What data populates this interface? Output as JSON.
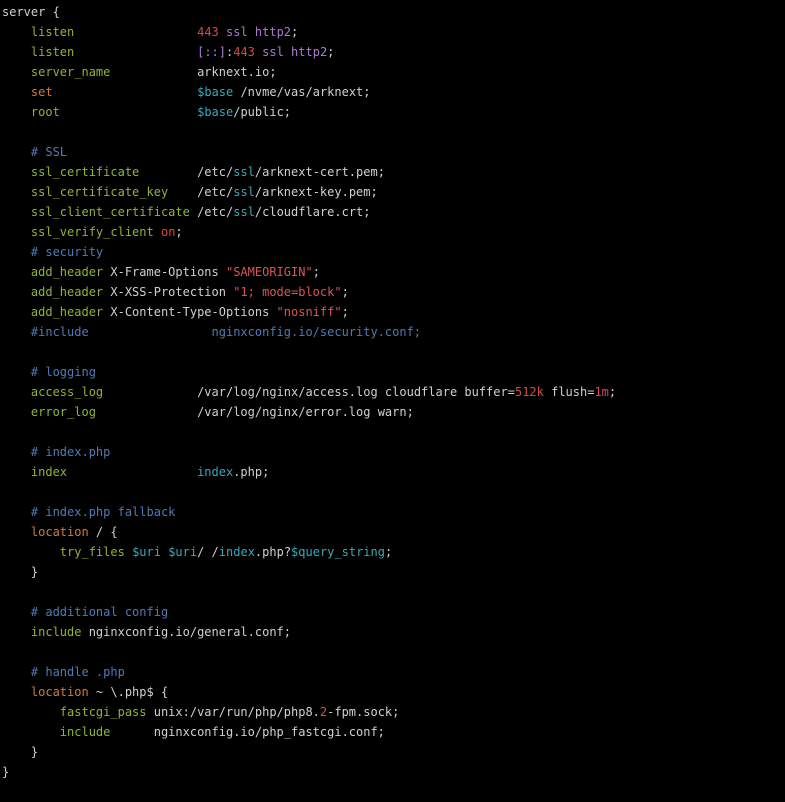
{
  "colors": {
    "background": "#000000",
    "text": "#d0d0d0",
    "keyword": "#8fb33a",
    "number": "#d74a4a",
    "modifier": "#a87bd0",
    "comment": "#4f7ab8",
    "string": "#d85555",
    "variable": "#3aa8b8",
    "location": "#d07a3a"
  },
  "lines": [
    [
      {
        "t": "server {",
        "c": "w"
      }
    ],
    [
      {
        "t": "    ",
        "c": "w"
      },
      {
        "t": "listen",
        "c": "k"
      },
      {
        "t": "                 ",
        "c": "w"
      },
      {
        "t": "443",
        "c": "n"
      },
      {
        "t": " ssl http2",
        "c": "m"
      },
      {
        "t": ";",
        "c": "w"
      }
    ],
    [
      {
        "t": "    ",
        "c": "w"
      },
      {
        "t": "listen",
        "c": "k"
      },
      {
        "t": "                 ",
        "c": "w"
      },
      {
        "t": "[::]",
        "c": "m"
      },
      {
        "t": ":",
        "c": "w"
      },
      {
        "t": "443",
        "c": "n"
      },
      {
        "t": " ssl http2",
        "c": "m"
      },
      {
        "t": ";",
        "c": "w"
      }
    ],
    [
      {
        "t": "    ",
        "c": "w"
      },
      {
        "t": "server_name",
        "c": "k"
      },
      {
        "t": "            arknext.io;",
        "c": "w"
      }
    ],
    [
      {
        "t": "    ",
        "c": "w"
      },
      {
        "t": "set",
        "c": "o"
      },
      {
        "t": "                    ",
        "c": "w"
      },
      {
        "t": "$base",
        "c": "v"
      },
      {
        "t": " /nvme/vas/arknext;",
        "c": "w"
      }
    ],
    [
      {
        "t": "    ",
        "c": "w"
      },
      {
        "t": "root",
        "c": "k"
      },
      {
        "t": "                   ",
        "c": "w"
      },
      {
        "t": "$base",
        "c": "v"
      },
      {
        "t": "/public;",
        "c": "w"
      }
    ],
    [
      {
        "t": "",
        "c": "w"
      }
    ],
    [
      {
        "t": "    ",
        "c": "w"
      },
      {
        "t": "# SSL",
        "c": "c"
      }
    ],
    [
      {
        "t": "    ",
        "c": "w"
      },
      {
        "t": "ssl_certificate",
        "c": "k"
      },
      {
        "t": "        /etc/",
        "c": "w"
      },
      {
        "t": "ssl",
        "c": "t"
      },
      {
        "t": "/arknext-cert.pem;",
        "c": "w"
      }
    ],
    [
      {
        "t": "    ",
        "c": "w"
      },
      {
        "t": "ssl_certificate_key",
        "c": "k"
      },
      {
        "t": "    /etc/",
        "c": "w"
      },
      {
        "t": "ssl",
        "c": "t"
      },
      {
        "t": "/arknext-key.pem;",
        "c": "w"
      }
    ],
    [
      {
        "t": "    ",
        "c": "w"
      },
      {
        "t": "ssl_client_certificate",
        "c": "k"
      },
      {
        "t": " /etc/",
        "c": "w"
      },
      {
        "t": "ssl",
        "c": "t"
      },
      {
        "t": "/cloudflare.crt;",
        "c": "w"
      }
    ],
    [
      {
        "t": "    ",
        "c": "w"
      },
      {
        "t": "ssl_verify_client",
        "c": "k"
      },
      {
        "t": " ",
        "c": "w"
      },
      {
        "t": "on",
        "c": "n"
      },
      {
        "t": ";",
        "c": "w"
      }
    ],
    [
      {
        "t": "    ",
        "c": "w"
      },
      {
        "t": "# security",
        "c": "c"
      }
    ],
    [
      {
        "t": "    ",
        "c": "w"
      },
      {
        "t": "add_header",
        "c": "k"
      },
      {
        "t": " X-Frame-Options ",
        "c": "w"
      },
      {
        "t": "\"SAMEORIGIN\"",
        "c": "s"
      },
      {
        "t": ";",
        "c": "w"
      }
    ],
    [
      {
        "t": "    ",
        "c": "w"
      },
      {
        "t": "add_header",
        "c": "k"
      },
      {
        "t": " X-XSS-Protection ",
        "c": "w"
      },
      {
        "t": "\"1; mode=block\"",
        "c": "s"
      },
      {
        "t": ";",
        "c": "w"
      }
    ],
    [
      {
        "t": "    ",
        "c": "w"
      },
      {
        "t": "add_header",
        "c": "k"
      },
      {
        "t": " X-Content-Type-Options ",
        "c": "w"
      },
      {
        "t": "\"nosniff\"",
        "c": "s"
      },
      {
        "t": ";",
        "c": "w"
      }
    ],
    [
      {
        "t": "    ",
        "c": "w"
      },
      {
        "t": "#include                 nginxconfig.io/security.conf;",
        "c": "c"
      }
    ],
    [
      {
        "t": "",
        "c": "w"
      }
    ],
    [
      {
        "t": "    ",
        "c": "w"
      },
      {
        "t": "# logging",
        "c": "c"
      }
    ],
    [
      {
        "t": "    ",
        "c": "w"
      },
      {
        "t": "access_log",
        "c": "k"
      },
      {
        "t": "             /var/log/nginx/access.log cloudflare buffer=",
        "c": "w"
      },
      {
        "t": "512k",
        "c": "n"
      },
      {
        "t": " flush=",
        "c": "w"
      },
      {
        "t": "1m",
        "c": "n"
      },
      {
        "t": ";",
        "c": "w"
      }
    ],
    [
      {
        "t": "    ",
        "c": "w"
      },
      {
        "t": "error_log",
        "c": "k"
      },
      {
        "t": "              /var/log/nginx/error.log warn;",
        "c": "w"
      }
    ],
    [
      {
        "t": "",
        "c": "w"
      }
    ],
    [
      {
        "t": "    ",
        "c": "w"
      },
      {
        "t": "# index.php",
        "c": "c"
      }
    ],
    [
      {
        "t": "    ",
        "c": "w"
      },
      {
        "t": "index",
        "c": "k"
      },
      {
        "t": "                  ",
        "c": "w"
      },
      {
        "t": "index",
        "c": "t"
      },
      {
        "t": ".php;",
        "c": "w"
      }
    ],
    [
      {
        "t": "",
        "c": "w"
      }
    ],
    [
      {
        "t": "    ",
        "c": "w"
      },
      {
        "t": "# index.php fallback",
        "c": "c"
      }
    ],
    [
      {
        "t": "    ",
        "c": "w"
      },
      {
        "t": "location",
        "c": "o"
      },
      {
        "t": " / {",
        "c": "w"
      }
    ],
    [
      {
        "t": "        ",
        "c": "w"
      },
      {
        "t": "try_files",
        "c": "k"
      },
      {
        "t": " ",
        "c": "w"
      },
      {
        "t": "$uri",
        "c": "v"
      },
      {
        "t": " ",
        "c": "w"
      },
      {
        "t": "$uri",
        "c": "v"
      },
      {
        "t": "/ /",
        "c": "w"
      },
      {
        "t": "index",
        "c": "t"
      },
      {
        "t": ".php?",
        "c": "w"
      },
      {
        "t": "$query_string",
        "c": "v"
      },
      {
        "t": ";",
        "c": "w"
      }
    ],
    [
      {
        "t": "    }",
        "c": "w"
      }
    ],
    [
      {
        "t": "",
        "c": "w"
      }
    ],
    [
      {
        "t": "    ",
        "c": "w"
      },
      {
        "t": "# additional config",
        "c": "c"
      }
    ],
    [
      {
        "t": "    ",
        "c": "w"
      },
      {
        "t": "include",
        "c": "k"
      },
      {
        "t": " nginxconfig.io/general.conf;",
        "c": "w"
      }
    ],
    [
      {
        "t": "",
        "c": "w"
      }
    ],
    [
      {
        "t": "    ",
        "c": "w"
      },
      {
        "t": "# handle .php",
        "c": "c"
      }
    ],
    [
      {
        "t": "    ",
        "c": "w"
      },
      {
        "t": "location",
        "c": "o"
      },
      {
        "t": " ~ \\.php$ {",
        "c": "w"
      }
    ],
    [
      {
        "t": "        ",
        "c": "w"
      },
      {
        "t": "fastcgi_pass",
        "c": "k"
      },
      {
        "t": " unix:/var/run/php/php8.",
        "c": "w"
      },
      {
        "t": "2",
        "c": "n"
      },
      {
        "t": "-fpm.sock;",
        "c": "w"
      }
    ],
    [
      {
        "t": "        ",
        "c": "w"
      },
      {
        "t": "include",
        "c": "k"
      },
      {
        "t": "      nginxconfig.io/php_fastcgi.conf;",
        "c": "w"
      }
    ],
    [
      {
        "t": "    }",
        "c": "w"
      }
    ],
    [
      {
        "t": "}",
        "c": "w"
      }
    ]
  ]
}
